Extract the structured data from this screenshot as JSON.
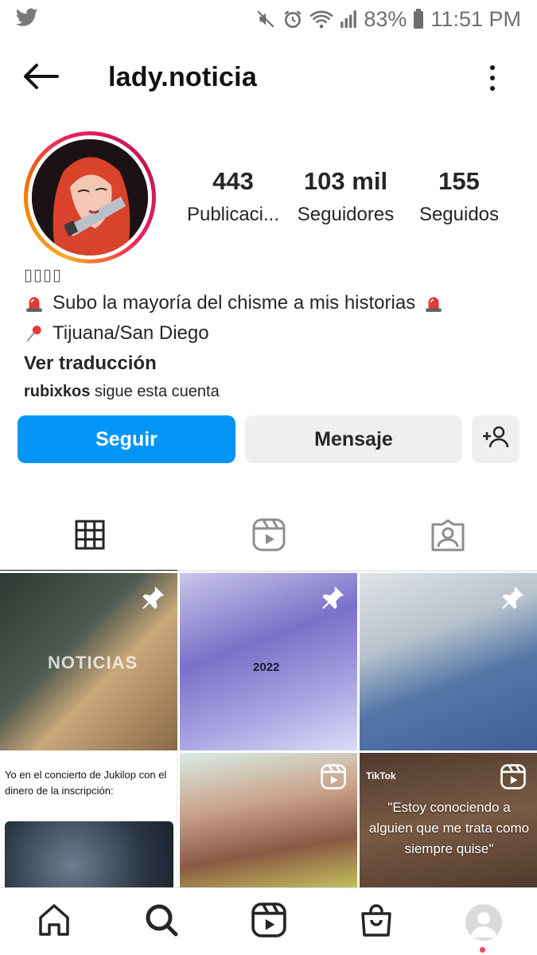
{
  "status_bar": {
    "battery": "83%",
    "time": "11:51 PM"
  },
  "header": {
    "username": "lady.noticia"
  },
  "profile": {
    "stats": [
      {
        "value": "443",
        "label": "Publicaci..."
      },
      {
        "value": "103 mil",
        "label": "Seguidores"
      },
      {
        "value": "155",
        "label": "Seguidos"
      }
    ],
    "name": "▯▯▯▯",
    "bio_line_1": "Subo la mayoría del chisme a mis historias",
    "bio_line_2": "Tijuana/San Diego",
    "translate": "Ver traducción",
    "followed_by_user": "rubixkos",
    "followed_by_text": "sigue esta cuenta"
  },
  "actions": {
    "follow": "Seguir",
    "message": "Mensaje"
  },
  "grid": {
    "tile_1_watermark": "NOTICIAS",
    "tile_2_text": "2022",
    "tile_4_caption": "Yo en el concierto de Jukilop con el dinero de la inscripción:",
    "tile_6_brand": "TikTok",
    "tile_6_quote": "\"Estoy conociendo a alguien que me trata como siempre quise\""
  },
  "colors": {
    "accent": "#0095f6",
    "notification": "#ed4956"
  },
  "icons": [
    "twitter-icon",
    "mute-icon",
    "alarm-icon",
    "wifi-icon",
    "signal-icon",
    "battery-icon",
    "back-arrow-icon",
    "more-vertical-icon",
    "add-user-icon",
    "grid-icon",
    "reels-icon",
    "tagged-icon",
    "pin-icon",
    "reel-badge-icon",
    "home-icon",
    "search-icon",
    "reels-nav-icon",
    "shop-icon",
    "profile-avatar"
  ]
}
